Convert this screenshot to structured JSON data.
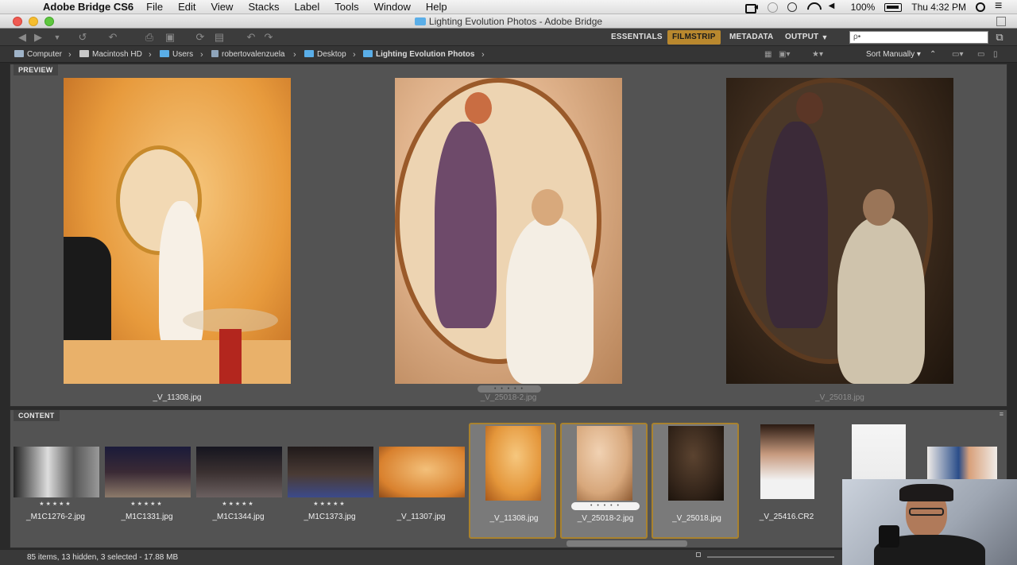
{
  "menubar": {
    "app_name": "Adobe Bridge CS6",
    "items": [
      "File",
      "Edit",
      "View",
      "Stacks",
      "Label",
      "Tools",
      "Window",
      "Help"
    ],
    "battery": "100%",
    "clock": "Thu 4:32 PM"
  },
  "window": {
    "title": "Lighting Evolution Photos - Adobe Bridge"
  },
  "toolbar": {
    "workspaces": [
      "ESSENTIALS",
      "FILMSTRIP",
      "METADATA",
      "OUTPUT"
    ],
    "active_workspace": "FILMSTRIP",
    "search_placeholder": "ρ•"
  },
  "pathbar": {
    "crumbs": [
      "Computer",
      "Macintosh HD",
      "Users",
      "robertovalenzuela",
      "Desktop",
      "Lighting Evolution Photos"
    ],
    "sort_label": "Sort Manually"
  },
  "preview": {
    "tab_label": "PREVIEW",
    "images": [
      {
        "caption": "_V_11308.jpg"
      },
      {
        "caption": "_V_25018-2.jpg"
      },
      {
        "caption": "_V_25018.jpg"
      }
    ]
  },
  "content": {
    "tab_label": "CONTENT",
    "thumbnails": [
      {
        "name": "_M1C1276-2.jpg",
        "stars": "★★★★★"
      },
      {
        "name": "_M1C1331.jpg",
        "stars": "★★★★★"
      },
      {
        "name": "_M1C1344.jpg",
        "stars": "★★★★★"
      },
      {
        "name": "_M1C1373.jpg",
        "stars": "★★★★★"
      },
      {
        "name": "_V_11307.jpg",
        "stars": ""
      },
      {
        "name": "_V_11308.jpg",
        "stars": ""
      },
      {
        "name": "_V_25018-2.jpg",
        "stars": "• • • • •"
      },
      {
        "name": "_V_25018.jpg",
        "stars": ""
      },
      {
        "name": "_V_25416.CR2",
        "stars": ""
      }
    ]
  },
  "status": {
    "text": "85 items, 13 hidden, 3 selected - 17.88 MB"
  },
  "colors": {
    "accent": "#b9882e",
    "panel": "#535353",
    "toolbar": "#3c3c3c"
  }
}
